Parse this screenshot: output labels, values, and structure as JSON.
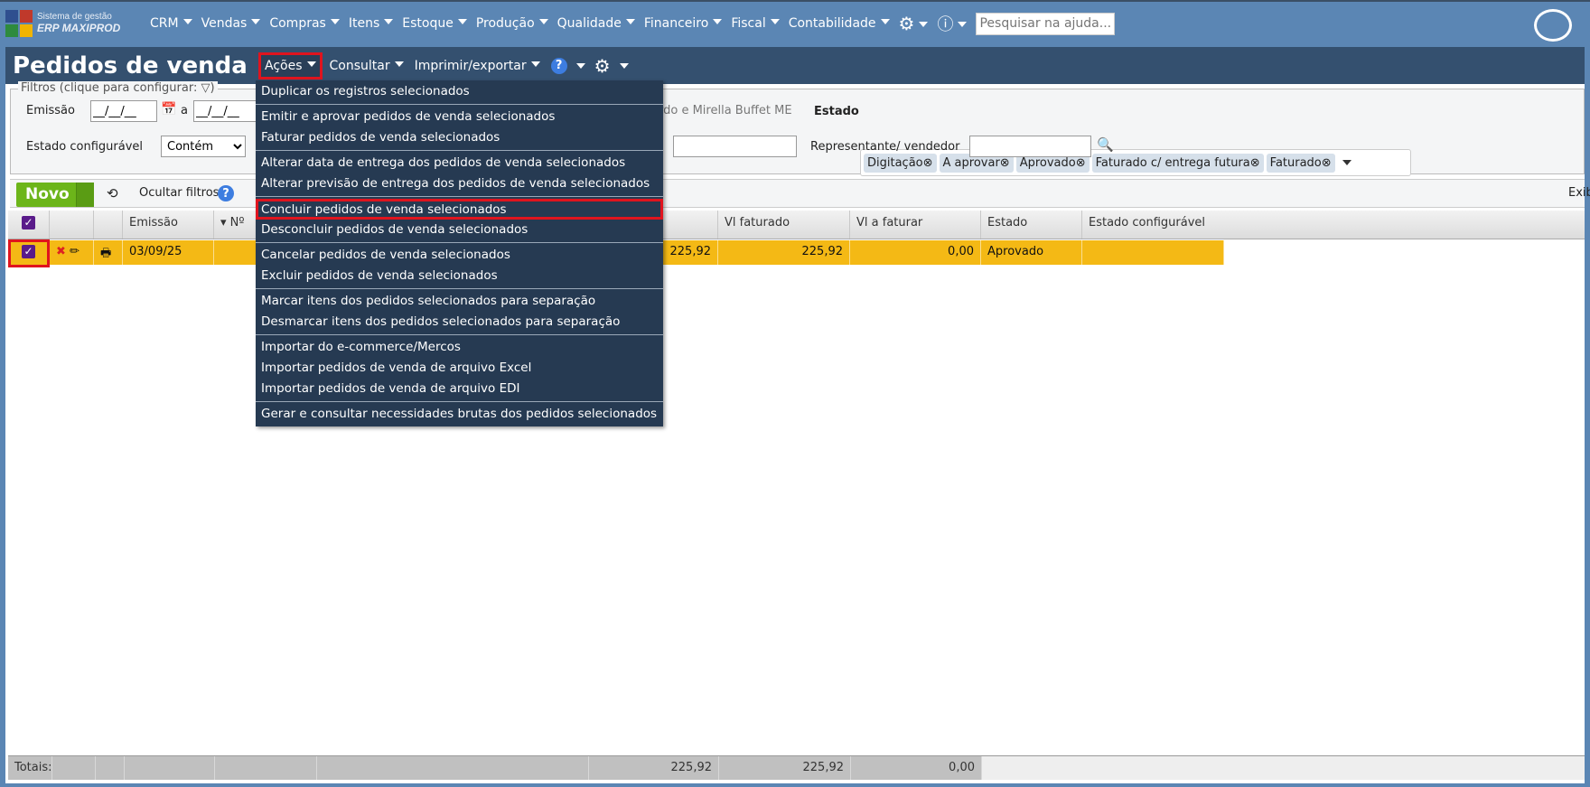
{
  "topnav": {
    "logo_line1": "Sistema de gestão",
    "logo_line2": "ERP MAXIPROD",
    "items": [
      "CRM",
      "Vendas",
      "Compras",
      "Itens",
      "Estoque",
      "Produção",
      "Qualidade",
      "Financeiro",
      "Fiscal",
      "Contabilidade"
    ],
    "search_placeholder": "Pesquisar na ajuda..."
  },
  "titlebar": {
    "title": "Pedidos de venda",
    "menus": [
      "Ações",
      "Consultar",
      "Imprimir/exportar"
    ],
    "help": "?"
  },
  "filters": {
    "legend": "Filtros (clique para configurar:",
    "legend_end": ")",
    "emissao_label": "Emissão",
    "date_from": "__/__/__",
    "date_to": "__/__/__",
    "a_label": "a",
    "estado_config_label": "Estado configurável",
    "estado_config_op": "Contém",
    "cliente_partial": "rdo e Mirella Buffet ME",
    "estado_label": "Estado",
    "estado_tags": [
      "Digitação",
      "A aprovar",
      "Aprovado",
      "Faturado c/ entrega futura",
      "Faturado"
    ],
    "representante_label": "Representante/ vendedor"
  },
  "toolbar": {
    "novo": "Novo",
    "ocultar": "Ocultar filtros",
    "exibir_partial": "Exib"
  },
  "table": {
    "headers": [
      "Emissão",
      "Nº",
      "Vl faturado",
      "Vl a faturar",
      "Estado",
      "Estado configurável"
    ],
    "row": {
      "emissao": "03/09/25",
      "vl_total": "225,92",
      "vl_faturado": "225,92",
      "vl_a_faturar": "0,00",
      "estado": "Aprovado"
    },
    "totals": {
      "label": "Totais:",
      "vl_total": "225,92",
      "vl_faturado": "225,92",
      "vl_a_faturar": "0,00"
    }
  },
  "menu": {
    "groups": [
      [
        "Duplicar os registros selecionados"
      ],
      [
        "Emitir e aprovar pedidos de venda selecionados",
        "Faturar pedidos de venda selecionados"
      ],
      [
        "Alterar data de entrega dos pedidos de venda selecionados",
        "Alterar previsão de entrega dos pedidos de venda selecionados"
      ],
      [
        "Concluir pedidos de venda selecionados",
        "Desconcluir pedidos de venda selecionados"
      ],
      [
        "Cancelar pedidos de venda selecionados",
        "Excluir pedidos de venda selecionados"
      ],
      [
        "Marcar itens dos pedidos selecionados para separação",
        "Desmarcar itens dos pedidos selecionados para separação"
      ],
      [
        "Importar do e-commerce/Mercos",
        "Importar pedidos de venda de arquivo Excel",
        "Importar pedidos de venda de arquivo EDI"
      ],
      [
        "Gerar e consultar necessidades brutas dos pedidos selecionados"
      ]
    ]
  }
}
